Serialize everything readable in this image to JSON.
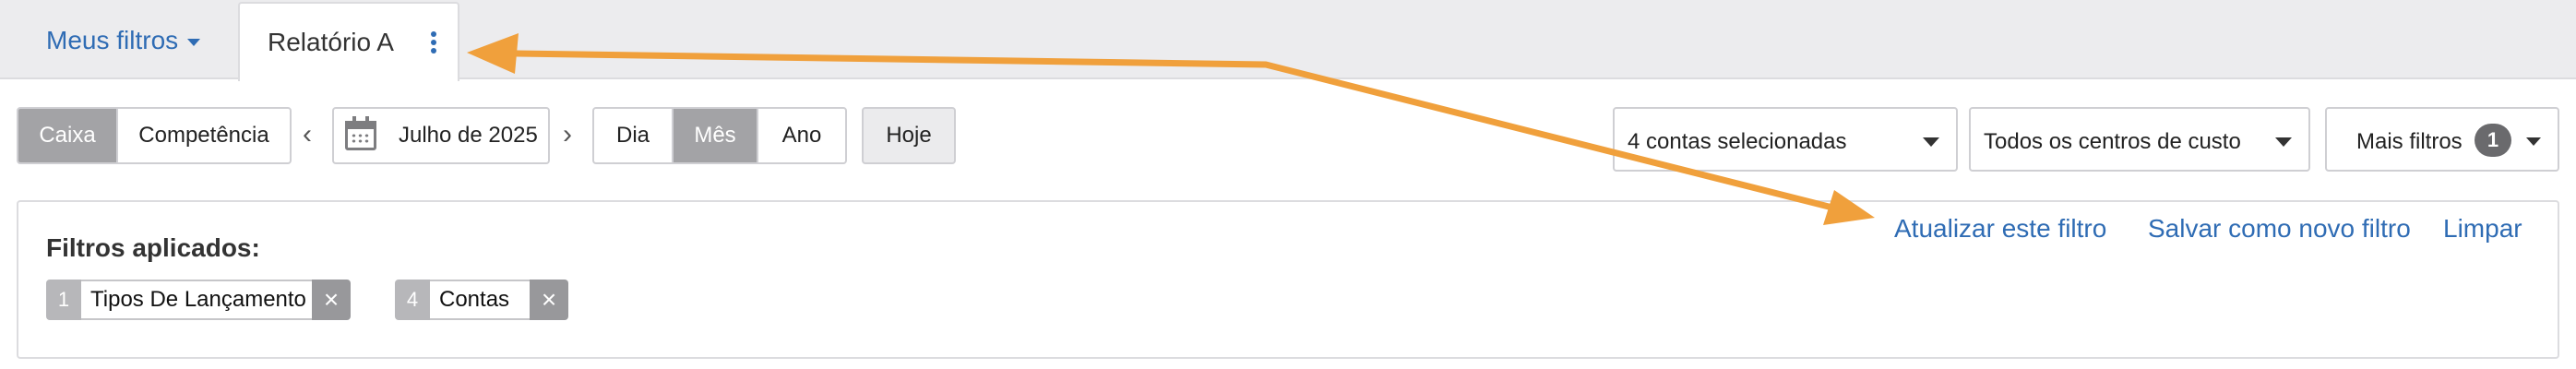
{
  "tabs": {
    "filters_menu": "Meus filtros",
    "active_tab": "Relatório A"
  },
  "toolbar": {
    "mode": {
      "cash": "Caixa",
      "accrual": "Competência",
      "selected": "Caixa"
    },
    "period": {
      "prev": "‹",
      "label": "Julho de 2025",
      "next": "›"
    },
    "granularity": {
      "day": "Dia",
      "month": "Mês",
      "year": "Ano",
      "selected": "Mês"
    },
    "today": "Hoje",
    "accounts_select": "4 contas selecionadas",
    "cost_centers_select": "Todos os centros de custo",
    "more_filters": {
      "label": "Mais filtros",
      "count": "1"
    }
  },
  "applied_filters": {
    "title": "Filtros aplicados:",
    "chips": [
      {
        "count": "1",
        "label": "Tipos De Lançamento",
        "remove": "×"
      },
      {
        "count": "4",
        "label": "Contas",
        "remove": "×"
      }
    ]
  },
  "actions": {
    "update": "Atualizar este filtro",
    "save_new": "Salvar como novo filtro",
    "clear": "Limpar"
  },
  "colors": {
    "link": "#2f6cb4",
    "annotation_arrow": "#f0a03c",
    "active_segment": "#a3a3a6"
  }
}
